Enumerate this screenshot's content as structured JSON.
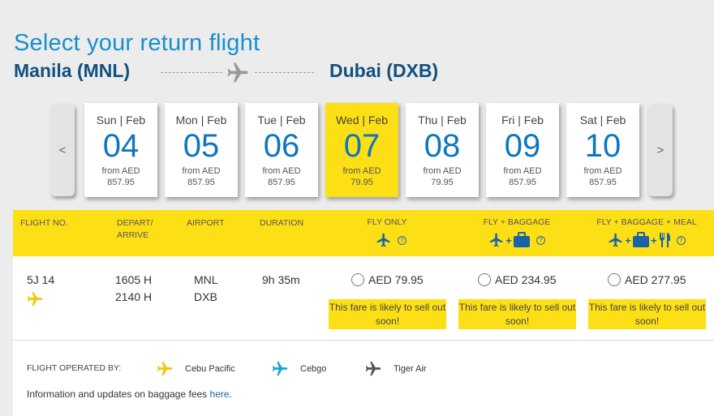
{
  "title": "Select your return flight",
  "route": {
    "origin": "Manila (MNL)",
    "destination": "Dubai (DXB)"
  },
  "nav": {
    "prev": "<",
    "next": ">"
  },
  "days": [
    {
      "name": "Sun | Feb",
      "num": "04",
      "from": "from AED",
      "price": "857.95",
      "selected": false
    },
    {
      "name": "Mon | Feb",
      "num": "05",
      "from": "from AED",
      "price": "857.95",
      "selected": false
    },
    {
      "name": "Tue | Feb",
      "num": "06",
      "from": "from AED",
      "price": "857.95",
      "selected": false
    },
    {
      "name": "Wed | Feb",
      "num": "07",
      "from": "from AED",
      "price": "79.95",
      "selected": true
    },
    {
      "name": "Thu | Feb",
      "num": "08",
      "from": "from AED",
      "price": "79.95",
      "selected": false
    },
    {
      "name": "Fri | Feb",
      "num": "09",
      "from": "from AED",
      "price": "857.95",
      "selected": false
    },
    {
      "name": "Sat | Feb",
      "num": "10",
      "from": "from AED",
      "price": "857.95",
      "selected": false
    }
  ],
  "headers": {
    "flight_no": "FLIGHT NO.",
    "depart_arrive": "DEPART/\nARRIVE",
    "airport": "AIRPORT",
    "duration": "DURATION",
    "fly_only": "FLY ONLY",
    "fly_baggage": "FLY + BAGGAGE",
    "fly_baggage_meal": "FLY + BAGGAGE + MEAL",
    "help": "?"
  },
  "flight": {
    "number": "5J 14",
    "depart": "1605 H",
    "arrive": "2140 H",
    "origin": "MNL",
    "destination": "DXB",
    "duration": "9h 35m",
    "fares": [
      {
        "price": "AED 79.95",
        "note": "This fare is likely to sell out soon!"
      },
      {
        "price": "AED 234.95",
        "note": "This fare is likely to sell out soon!"
      },
      {
        "price": "AED 277.95",
        "note": "This fare is likely to sell out soon!"
      }
    ]
  },
  "footer": {
    "operated_by": "FLIGHT OPERATED BY:",
    "carriers": [
      {
        "name": "Cebu Pacific",
        "color": "#f5c400"
      },
      {
        "name": "Cebgo",
        "color": "#1aa3d4"
      },
      {
        "name": "Tiger Air",
        "color": "#555555"
      }
    ],
    "info_text": "Information and updates on baggage fees ",
    "info_link": "here",
    "info_end": "."
  },
  "colors": {
    "accent_yellow": "#fddf15",
    "brand_blue": "#1a8fce",
    "dark_blue": "#13507e"
  }
}
